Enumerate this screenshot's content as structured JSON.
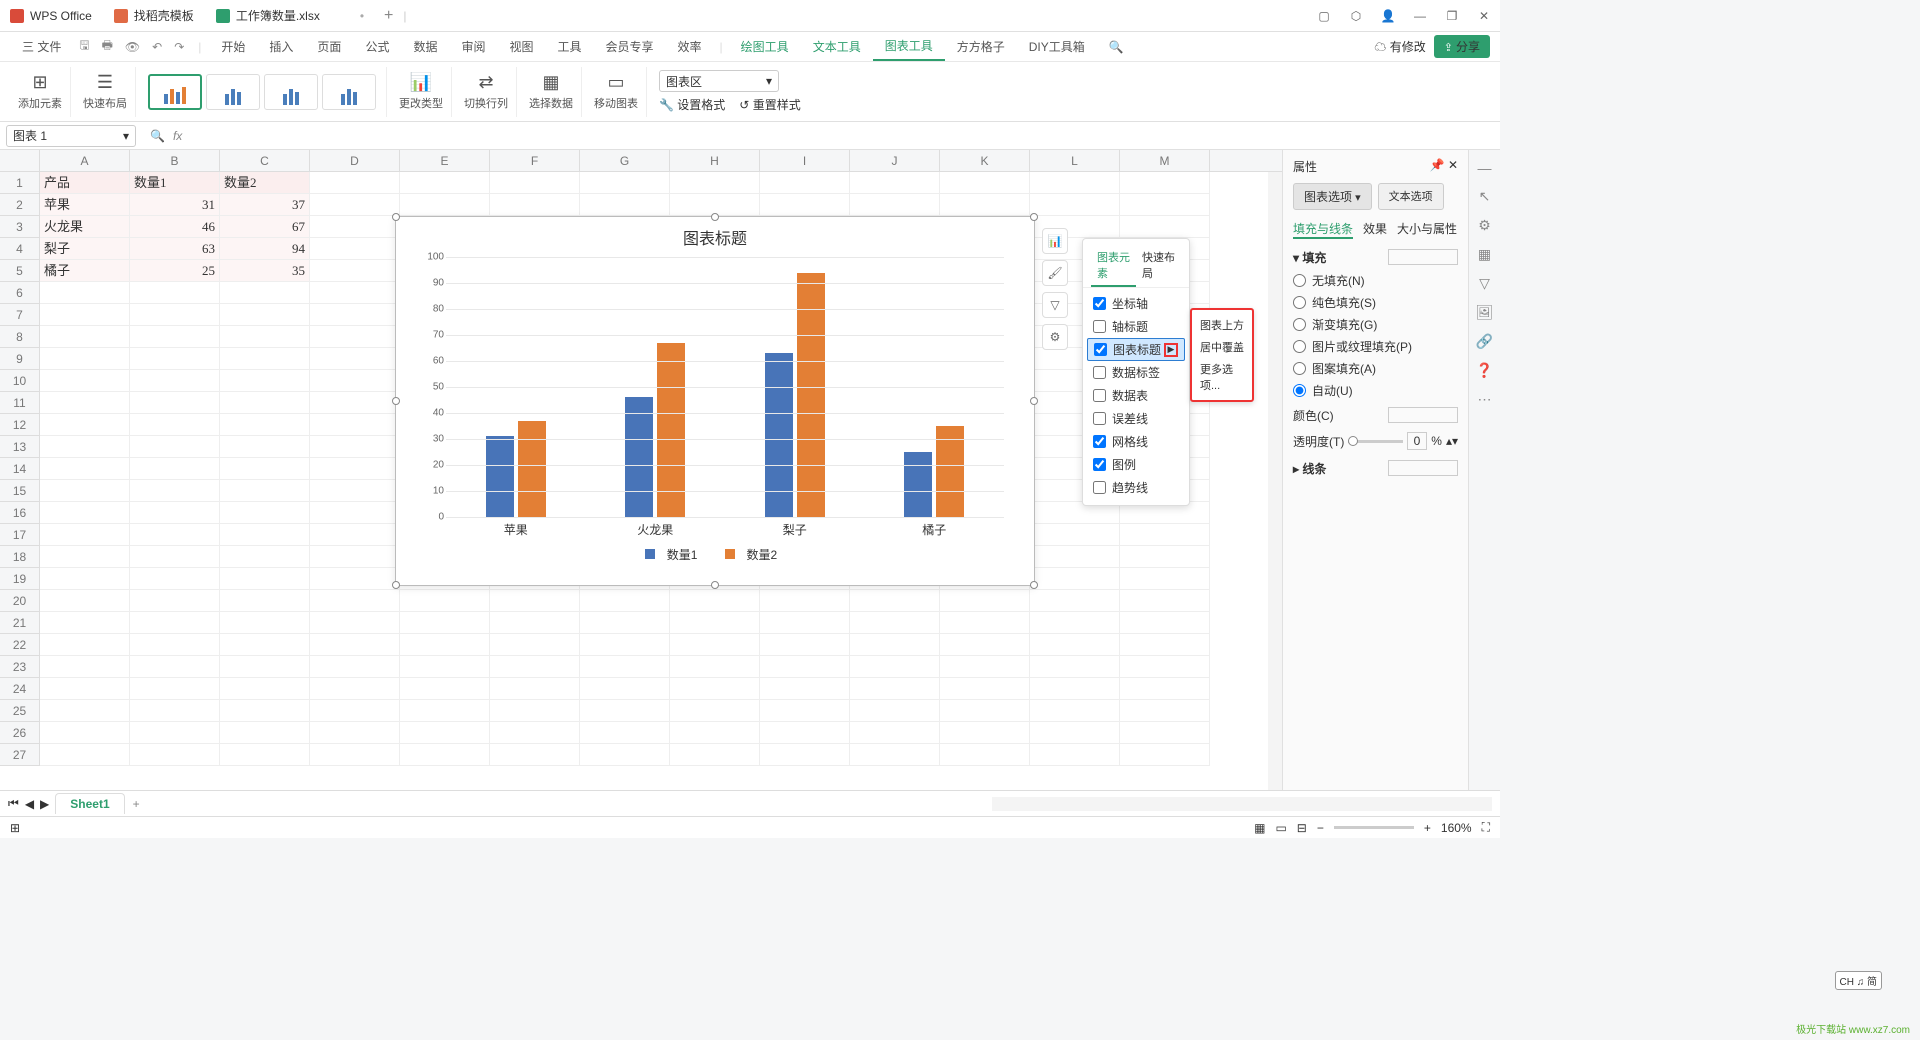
{
  "titlebar": {
    "tabs": [
      {
        "label": "WPS Office",
        "color": "#d94b3a"
      },
      {
        "label": "找稻壳模板",
        "color": "#e06a45"
      },
      {
        "label": "工作簿数量.xlsx",
        "color": "#2e9e6e",
        "active": true
      }
    ]
  },
  "menubar": {
    "left_icon": "三 文件",
    "items": [
      "开始",
      "插入",
      "页面",
      "公式",
      "数据",
      "审阅",
      "视图",
      "工具",
      "会员专享",
      "效率"
    ],
    "green_items": [
      "绘图工具",
      "文本工具",
      "图表工具",
      "方方格子",
      "DIY工具箱"
    ],
    "active": "图表工具",
    "mod_label": "有修改",
    "share_label": "分享"
  },
  "ribbon": {
    "add_element": "添加元素",
    "quick_layout": "快速布局",
    "change_type": "更改类型",
    "switch_rc": "切换行列",
    "select_data": "选择数据",
    "move_chart": "移动图表",
    "set_format": "设置格式",
    "reset_style": "重置样式",
    "chart_area_label": "图表区"
  },
  "namebox": "图表 1",
  "sheet": {
    "cols": [
      "A",
      "B",
      "C",
      "D",
      "E",
      "F",
      "G",
      "H",
      "I",
      "J",
      "K",
      "L",
      "M"
    ],
    "rows_count": 27,
    "data": [
      [
        "产品",
        "数量1",
        "数量2"
      ],
      [
        "苹果",
        "31",
        "37"
      ],
      [
        "火龙果",
        "46",
        "67"
      ],
      [
        "梨子",
        "63",
        "94"
      ],
      [
        "橘子",
        "25",
        "35"
      ]
    ]
  },
  "chart_data": {
    "type": "bar",
    "title": "图表标题",
    "categories": [
      "苹果",
      "火龙果",
      "梨子",
      "橘子"
    ],
    "series": [
      {
        "name": "数量1",
        "values": [
          31,
          46,
          63,
          25
        ],
        "color": "#4874b8"
      },
      {
        "name": "数量2",
        "values": [
          37,
          67,
          94,
          35
        ],
        "color": "#e37f35"
      }
    ],
    "ylim": [
      0,
      100
    ],
    "ytick": 10,
    "xlabel": "",
    "ylabel": ""
  },
  "chart_popup": {
    "tabs": [
      "图表元素",
      "快速布局"
    ],
    "items": [
      {
        "label": "坐标轴",
        "checked": true
      },
      {
        "label": "轴标题",
        "checked": false
      },
      {
        "label": "图表标题",
        "checked": true,
        "highlight": true,
        "arrow": true
      },
      {
        "label": "数据标签",
        "checked": false
      },
      {
        "label": "数据表",
        "checked": false
      },
      {
        "label": "误差线",
        "checked": false
      },
      {
        "label": "网格线",
        "checked": true
      },
      {
        "label": "图例",
        "checked": true
      },
      {
        "label": "趋势线",
        "checked": false
      }
    ],
    "submenu": [
      "图表上方",
      "居中覆盖",
      "更多选项..."
    ]
  },
  "prop_pane": {
    "title": "属性",
    "tabs": [
      "图表选项",
      "文本选项"
    ],
    "subtabs": [
      "填充与线条",
      "效果",
      "大小与属性"
    ],
    "fill_hdr": "填充",
    "fill_opts": [
      "无填充(N)",
      "纯色填充(S)",
      "渐变填充(G)",
      "图片或纹理填充(P)",
      "图案填充(A)",
      "自动(U)"
    ],
    "fill_selected": "自动(U)",
    "color_label": "颜色(C)",
    "opacity_label": "透明度(T)",
    "opacity_val": "0",
    "opacity_unit": "%",
    "line_hdr": "线条"
  },
  "sheet_tab": "Sheet1",
  "status": {
    "zoom": "160%",
    "ime": "CH ♫ 简"
  },
  "watermark": "极光下载站 www.xz7.com"
}
